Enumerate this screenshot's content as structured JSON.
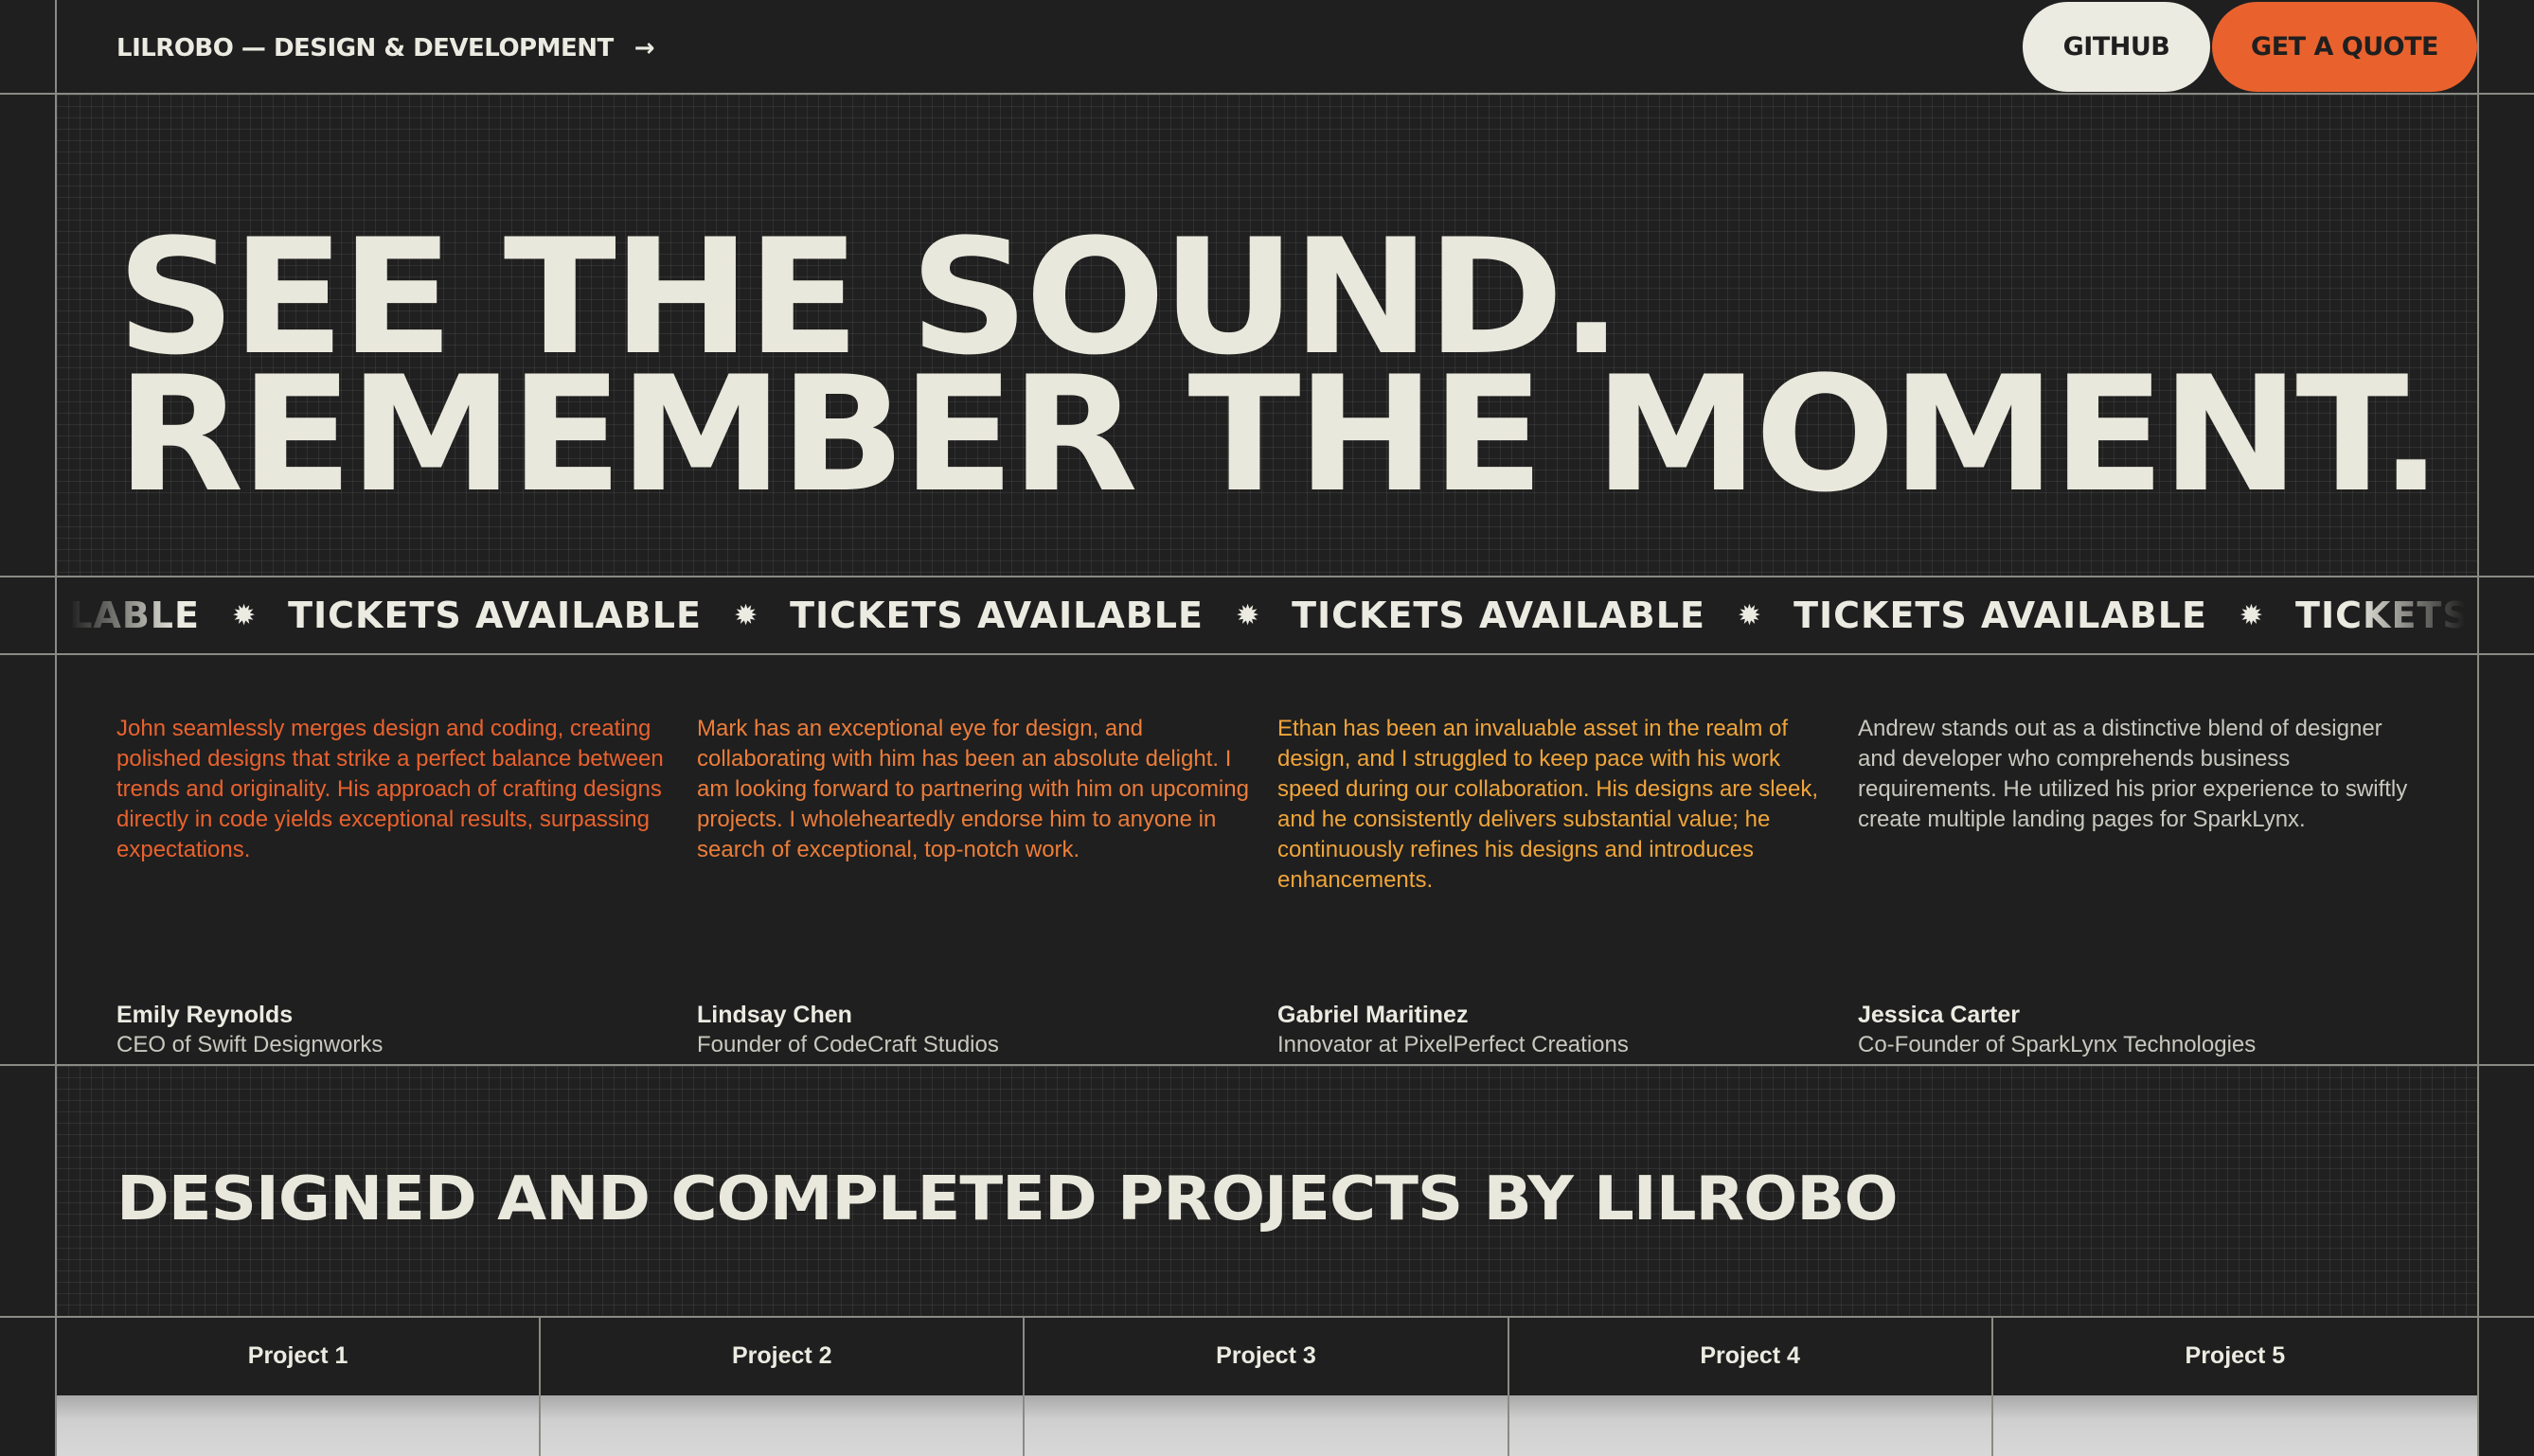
{
  "header": {
    "brand": "LILROBO — DESIGN & DEVELOPMENT",
    "brand_arrow": "→",
    "github_label": "GITHUB",
    "quote_label": "GET A QUOTE"
  },
  "hero": {
    "line1": "SEE THE SOUND.",
    "line2": "REMEMBER THE MOMENT."
  },
  "ticker": {
    "partial_start": "AVAILABLE",
    "items": [
      "TICKETS AVAILABLE",
      "TICKETS AVAILABLE",
      "TICKETS AVAILABLE",
      "TICKETS AVAILABLE"
    ],
    "partial_end": "TICKETS",
    "separator": "✹"
  },
  "testimonials": [
    {
      "quote": "John seamlessly merges design and coding, creating polished designs that strike a perfect balance between trends and originality. His approach of crafting designs directly in code yields exceptional results, surpassing expectations.",
      "name": "Emily Reynolds",
      "role": "CEO of Swift Designworks",
      "color": "#e9622e"
    },
    {
      "quote": "Mark has an exceptional eye for design, and collaborating with him has been an absolute delight. I am looking forward to partnering with him on upcoming projects. I wholeheartedly endorse him to anyone in search of exceptional, top-notch work.",
      "name": "Lindsay Chen",
      "role": "Founder of CodeCraft Studios",
      "color": "#ec7d3a"
    },
    {
      "quote": "Ethan has been an invaluable asset in the realm of design, and I struggled to keep pace with his work speed during our collaboration. His designs are sleek, and he consistently delivers substantial value; he continuously refines his designs and introduces enhancements.",
      "name": "Gabriel Maritinez",
      "role": "Innovator at PixelPerfect Creations",
      "color": "#f0a53a"
    },
    {
      "quote": "Andrew stands out as a distinctive blend of designer and developer who comprehends business requirements. He utilized his prior experience to swiftly create multiple landing pages for SparkLynx.",
      "name": "Jessica Carter",
      "role": "Co-Founder of SparkLynx Technologies",
      "color": "#c9c8bf"
    }
  ],
  "projects": {
    "title": "DESIGNED AND COMPLETED PROJECTS BY LILROBO",
    "tabs": [
      "Project 1",
      "Project 2",
      "Project 3",
      "Project 4",
      "Project 5"
    ]
  }
}
